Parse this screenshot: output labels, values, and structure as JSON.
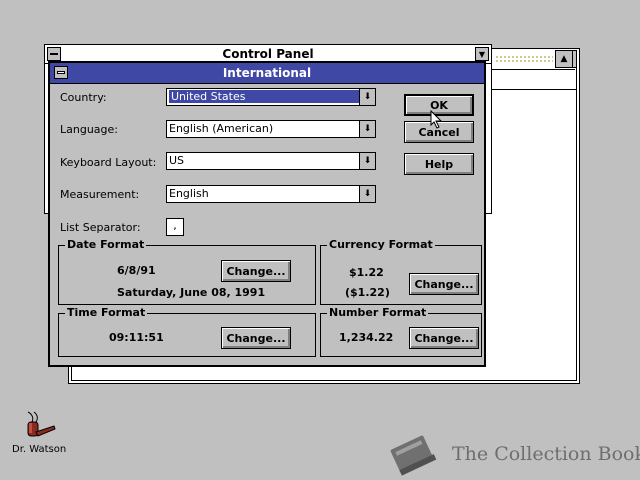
{
  "control_panel": {
    "title": "Control Panel"
  },
  "dialog": {
    "title": "International",
    "fields": {
      "country": {
        "label": "Country:",
        "value": "United States"
      },
      "language": {
        "label": "Language:",
        "value": "English (American)"
      },
      "keyboard": {
        "label": "Keyboard Layout:",
        "value": "US"
      },
      "measurement": {
        "label": "Measurement:",
        "value": "English"
      },
      "list_separator": {
        "label": "List Separator:",
        "value": ","
      }
    },
    "buttons": {
      "ok": "OK",
      "cancel": "Cancel",
      "help": "Help"
    },
    "date_format": {
      "label": "Date Format",
      "short": "6/8/91",
      "long": "Saturday, June 08, 1991",
      "change": "Change..."
    },
    "currency_format": {
      "label": "Currency Format",
      "positive": "$1.22",
      "negative": "($1.22)",
      "change": "Change..."
    },
    "time_format": {
      "label": "Time Format",
      "value": "09:11:51",
      "change": "Change..."
    },
    "number_format": {
      "label": "Number Format",
      "value": "1,234.22",
      "change": "Change..."
    }
  },
  "desktop": {
    "dr_watson_label": "Dr. Watson",
    "watermark_text": "The Collection Book"
  },
  "colors": {
    "title_bar": "#3f48a5",
    "desktop": "#c0c0c0"
  }
}
